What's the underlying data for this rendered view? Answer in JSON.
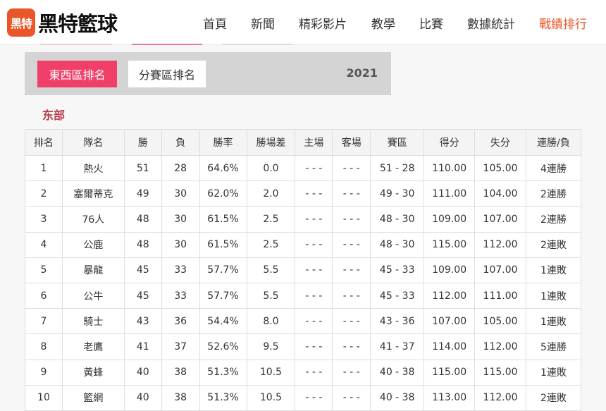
{
  "header": {
    "logo_badge": "黑特",
    "logo_text": "黑特籃球",
    "nav": [
      {
        "label": "首頁"
      },
      {
        "label": "新聞"
      },
      {
        "label": "精彩影片"
      },
      {
        "label": "教學"
      },
      {
        "label": "比賽"
      },
      {
        "label": "數據統計"
      },
      {
        "label": "戰績排行",
        "active": true
      }
    ],
    "accent_color": "#e8562a"
  },
  "controls": {
    "tab_east_west": "東西區排名",
    "tab_division": "分賽區排名",
    "year": "2021",
    "active_color": "#f0406a"
  },
  "section_title": "东部",
  "table": {
    "columns": [
      "排名",
      "隊名",
      "勝",
      "負",
      "勝率",
      "勝場差",
      "主場",
      "客場",
      "賽區",
      "得分",
      "失分",
      "連勝/負"
    ],
    "rows": [
      [
        "1",
        "熱火",
        "51",
        "28",
        "64.6%",
        "0.0",
        "- - -",
        "- - -",
        "51 - 28",
        "110.00",
        "105.00",
        "4連勝"
      ],
      [
        "2",
        "塞爾蒂克",
        "49",
        "30",
        "62.0%",
        "2.0",
        "- - -",
        "- - -",
        "49 - 30",
        "111.00",
        "104.00",
        "2連勝"
      ],
      [
        "3",
        "76人",
        "48",
        "30",
        "61.5%",
        "2.5",
        "- - -",
        "- - -",
        "48 - 30",
        "109.00",
        "107.00",
        "2連勝"
      ],
      [
        "4",
        "公鹿",
        "48",
        "30",
        "61.5%",
        "2.5",
        "- - -",
        "- - -",
        "48 - 30",
        "115.00",
        "112.00",
        "2連敗"
      ],
      [
        "5",
        "暴龍",
        "45",
        "33",
        "57.7%",
        "5.5",
        "- - -",
        "- - -",
        "45 - 33",
        "109.00",
        "107.00",
        "1連敗"
      ],
      [
        "6",
        "公牛",
        "45",
        "33",
        "57.7%",
        "5.5",
        "- - -",
        "- - -",
        "45 - 33",
        "112.00",
        "111.00",
        "1連敗"
      ],
      [
        "7",
        "騎士",
        "43",
        "36",
        "54.4%",
        "8.0",
        "- - -",
        "- - -",
        "43 - 36",
        "107.00",
        "105.00",
        "1連敗"
      ],
      [
        "8",
        "老鷹",
        "41",
        "37",
        "52.6%",
        "9.5",
        "- - -",
        "- - -",
        "41 - 37",
        "114.00",
        "112.00",
        "5連勝"
      ],
      [
        "9",
        "黃蜂",
        "40",
        "38",
        "51.3%",
        "10.5",
        "- - -",
        "- - -",
        "40 - 38",
        "115.00",
        "115.00",
        "1連敗"
      ],
      [
        "10",
        "籃網",
        "40",
        "38",
        "51.3%",
        "10.5",
        "- - -",
        "- - -",
        "40 - 38",
        "113.00",
        "112.00",
        "2連敗"
      ]
    ]
  }
}
